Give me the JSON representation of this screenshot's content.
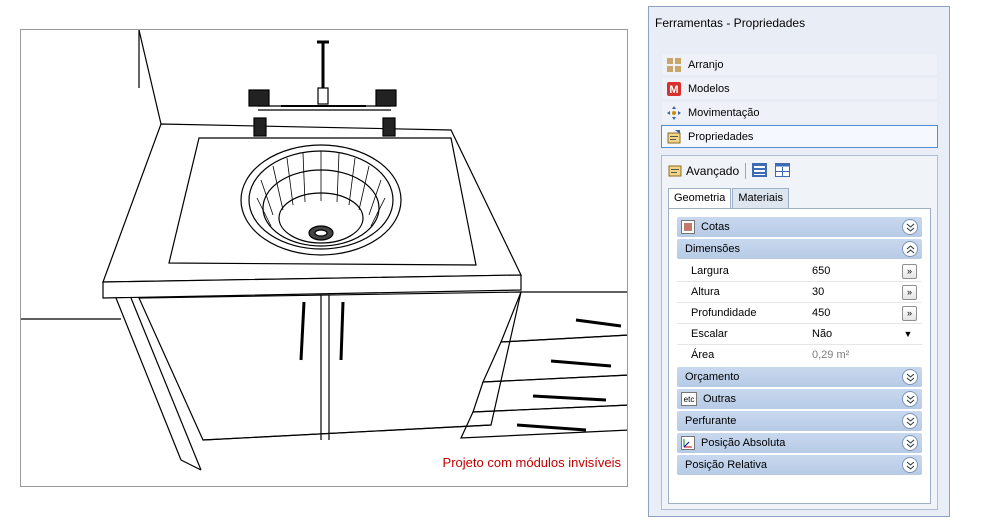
{
  "viewport": {
    "caption": "Projeto com módulos invisíveis"
  },
  "panel": {
    "title": "Ferramentas - Propriedades",
    "tools": [
      {
        "label": "Arranjo",
        "icon": "arrange-icon"
      },
      {
        "label": "Modelos",
        "icon": "models-m-icon"
      },
      {
        "label": "Movimentação",
        "icon": "move-arrows-icon"
      },
      {
        "label": "Propriedades",
        "icon": "properties-icon"
      }
    ],
    "advanced_label": "Avançado",
    "tabs": [
      "Geometria",
      "Materiais"
    ],
    "sections": {
      "cotas": "Cotas",
      "dimensoes": "Dimensões",
      "orcamento": "Orçamento",
      "outras": "Outras",
      "outras_icon_text": "etc",
      "perfurante": "Perfurante",
      "posicao_absoluta": "Posição Absoluta",
      "posicao_relativa": "Posição Relativa"
    },
    "properties": [
      {
        "label": "Largura",
        "value": "650",
        "button": "»"
      },
      {
        "label": "Altura",
        "value": "30",
        "button": "»"
      },
      {
        "label": "Profundidade",
        "value": "450",
        "button": "»"
      },
      {
        "label": "Escalar",
        "value": "Não",
        "button": "▼"
      },
      {
        "label": "Área",
        "value": "0,29 m²",
        "button": ""
      }
    ]
  },
  "colors": {
    "caption": "#c00000",
    "section_header": "#bfd1ea",
    "selection_border": "#4f8fd6"
  }
}
